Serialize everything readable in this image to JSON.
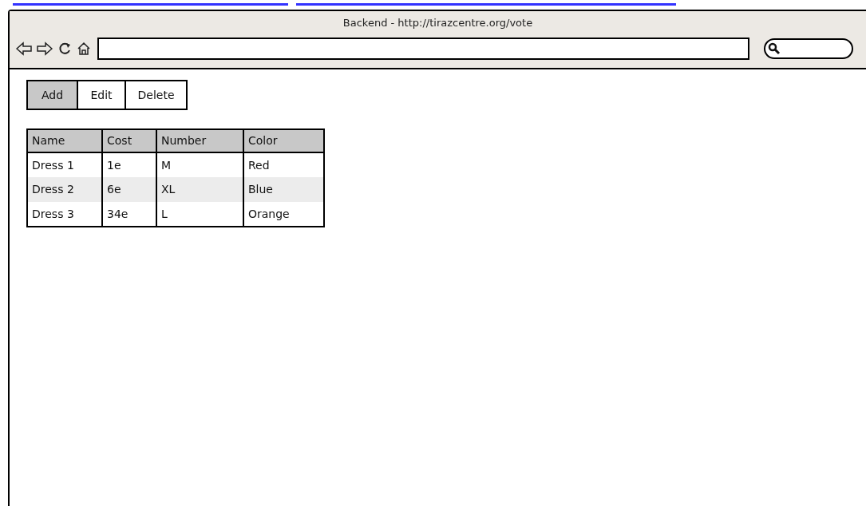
{
  "window": {
    "title": "Backend - http://tirazcentre.org/vote"
  },
  "toolbar": [
    {
      "label": "Add",
      "selected": true
    },
    {
      "label": "Edit",
      "selected": false
    },
    {
      "label": "Delete",
      "selected": false
    }
  ],
  "table": {
    "columns": [
      "Name",
      "Cost",
      "Number",
      "Color"
    ],
    "rows": [
      [
        "Dress 1",
        "1e",
        "M",
        "Red"
      ],
      [
        "Dress 2",
        "6e",
        "XL",
        "Blue"
      ],
      [
        "Dress 3",
        "34e",
        "L",
        "Orange"
      ]
    ]
  }
}
